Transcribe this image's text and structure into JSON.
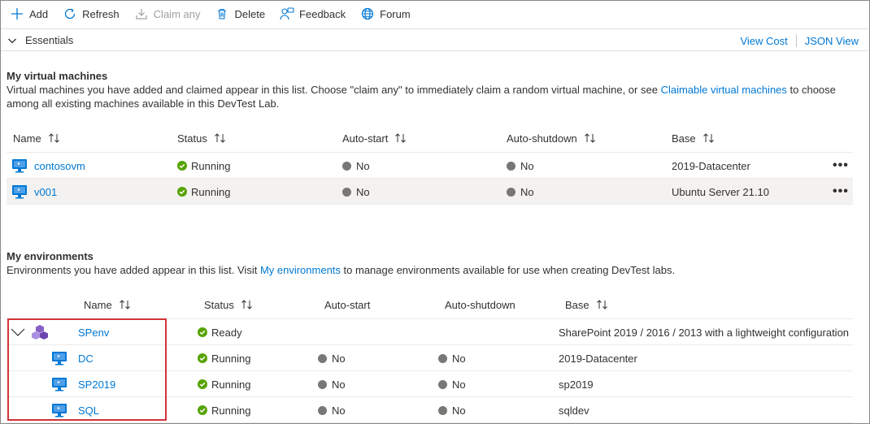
{
  "toolbar": {
    "add": "Add",
    "refresh": "Refresh",
    "claim_any": "Claim any",
    "delete": "Delete",
    "feedback": "Feedback",
    "forum": "Forum"
  },
  "essentials": {
    "label": "Essentials",
    "view_cost": "View Cost",
    "json_view": "JSON View"
  },
  "vms": {
    "title": "My virtual machines",
    "desc_part1": "Virtual machines you have added and claimed appear in this list. Choose \"claim any\" to immediately claim a random virtual machine, or see ",
    "desc_link": "Claimable virtual machines",
    "desc_part2": " to choose among all existing machines available in this DevTest Lab.",
    "columns": [
      "Name",
      "Status",
      "Auto-start",
      "Auto-shutdown",
      "Base"
    ],
    "rows": [
      {
        "name": "contosovm",
        "status": "Running",
        "auto_start": "No",
        "auto_shutdown": "No",
        "base": "2019-Datacenter",
        "more": "•••"
      },
      {
        "name": "v001",
        "status": "Running",
        "auto_start": "No",
        "auto_shutdown": "No",
        "base": "Ubuntu Server 21.10",
        "more": "•••"
      }
    ]
  },
  "envs": {
    "title": "My environments",
    "desc_part1": "Environments you have added appear in this list. Visit ",
    "desc_link": "My environments",
    "desc_part2": " to manage environments available for use when creating DevTest labs.",
    "columns": [
      "Name",
      "Status",
      "Auto-start",
      "Auto-shutdown",
      "Base"
    ],
    "group": {
      "name": "SPenv",
      "status": "Ready",
      "base": "SharePoint 2019 / 2016 / 2013 with a lightweight configuration"
    },
    "rows": [
      {
        "name": "DC",
        "status": "Running",
        "auto_start": "No",
        "auto_shutdown": "No",
        "base": "2019-Datacenter"
      },
      {
        "name": "SP2019",
        "status": "Running",
        "auto_start": "No",
        "auto_shutdown": "No",
        "base": "sp2019"
      },
      {
        "name": "SQL",
        "status": "Running",
        "auto_start": "No",
        "auto_shutdown": "No",
        "base": "sqldev"
      }
    ]
  },
  "colors": {
    "link": "#0078d4",
    "success": "#57a300",
    "highlight": "#d13438"
  }
}
